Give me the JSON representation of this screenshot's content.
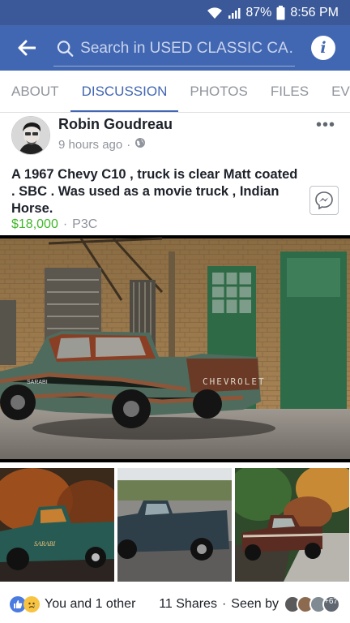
{
  "status_bar": {
    "battery": "87%",
    "time": "8:56 PM"
  },
  "app_bar": {
    "search_placeholder": "Search in USED CLASSIC CA…"
  },
  "tabs": [
    "ABOUT",
    "DISCUSSION",
    "PHOTOS",
    "FILES",
    "EVENTS"
  ],
  "active_tab": "DISCUSSION",
  "post": {
    "author": "Robin Goudreau",
    "time": "9 hours ago",
    "separator": "·",
    "text": "A 1967 Chevy C10 , truck is clear Matt coated . SBC . Was used as a movie truck , Indian Horse.",
    "price": "$18,000",
    "location": "P3C",
    "photo_text": {
      "tailgate": "CHEVROLET",
      "door": "SARABI",
      "thumb1_door": "SARABI"
    }
  },
  "footer": {
    "reactions": "You and 1 other",
    "shares": "11 Shares",
    "seen_label": "Seen by",
    "seen_count": "+67"
  },
  "colors": {
    "header": "#4267b2",
    "status": "#3b5998",
    "price": "#42b72a",
    "accent": "#4267b2"
  },
  "icons": [
    "wifi-icon",
    "signal-icon",
    "battery-icon",
    "back-arrow-icon",
    "search-icon",
    "info-icon",
    "globe-icon",
    "more-icon",
    "messenger-icon",
    "like-reaction-icon",
    "sad-reaction-icon"
  ]
}
